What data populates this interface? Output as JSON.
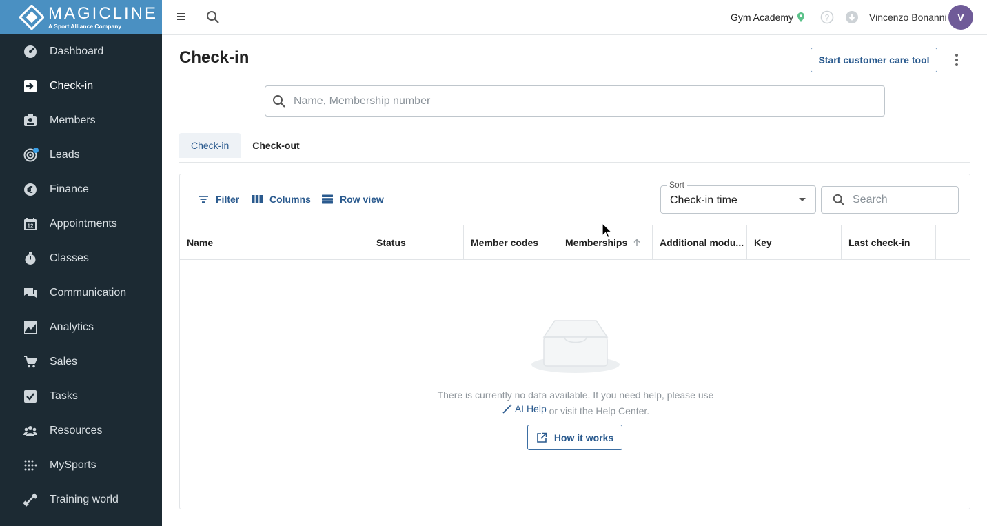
{
  "brand": {
    "name": "MAGICLINE",
    "tagline": "A Sport Alliance Company"
  },
  "sidebar": {
    "items": [
      {
        "label": "Dashboard",
        "icon": "dashboard-icon"
      },
      {
        "label": "Check-in",
        "icon": "check-in-icon",
        "active": true
      },
      {
        "label": "Members",
        "icon": "members-icon"
      },
      {
        "label": "Leads",
        "icon": "leads-icon",
        "has_notification_dot": true
      },
      {
        "label": "Finance",
        "icon": "euro-icon"
      },
      {
        "label": "Appointments",
        "icon": "calendar-icon"
      },
      {
        "label": "Classes",
        "icon": "stopwatch-icon"
      },
      {
        "label": "Communication",
        "icon": "chat-icon"
      },
      {
        "label": "Analytics",
        "icon": "chart-icon"
      },
      {
        "label": "Sales",
        "icon": "cart-icon"
      },
      {
        "label": "Tasks",
        "icon": "check-box-icon"
      },
      {
        "label": "Resources",
        "icon": "people-icon"
      },
      {
        "label": "MySports",
        "icon": "dots-grid-icon"
      },
      {
        "label": "Training world",
        "icon": "dumbbell-icon"
      }
    ]
  },
  "topbar": {
    "studio": "Gym Academy",
    "user_name": "Vincenzo Bonanni",
    "avatar_initial": "V"
  },
  "page": {
    "title": "Check-in",
    "customer_care_button": "Start customer care tool",
    "search_placeholder": "Name, Membership number"
  },
  "tabs": [
    {
      "label": "Check-in",
      "active": true
    },
    {
      "label": "Check-out",
      "active": false
    }
  ],
  "toolbar": {
    "filter": "Filter",
    "columns": "Columns",
    "row_view": "Row view",
    "sort_label": "Sort",
    "sort_value": "Check-in time",
    "search_placeholder": "Search"
  },
  "table": {
    "columns": [
      "Name",
      "Status",
      "Member codes",
      "Memberships",
      "Additional modu...",
      "Key",
      "Last check-in"
    ],
    "sorted_column": "Memberships"
  },
  "empty_state": {
    "text_before": "There is currently no data available. If you need help, please use",
    "ai_help": "AI Help",
    "text_after": "or visit the Help Center.",
    "button": "How it works"
  },
  "colors": {
    "sidebar_bg": "#1c2a33",
    "brand_blue": "#4a90c2",
    "accent": "#2a5a8e",
    "avatar": "#6f5b98"
  }
}
